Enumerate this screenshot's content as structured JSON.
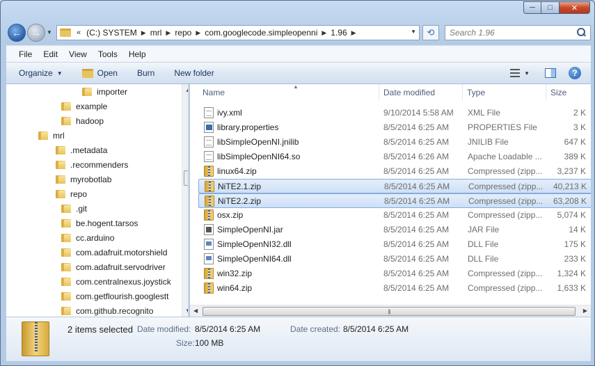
{
  "window": {
    "buttons": {
      "minimize": "─",
      "maximize": "□",
      "close": "✕"
    }
  },
  "address": {
    "prefix": "«",
    "crumbs": [
      "(C:) SYSTEM",
      "mrl",
      "repo",
      "com.googlecode.simpleopenni",
      "1.96"
    ],
    "search_placeholder": "Search 1.96"
  },
  "menu": [
    "File",
    "Edit",
    "View",
    "Tools",
    "Help"
  ],
  "commands": {
    "organize": "Organize",
    "open": "Open",
    "burn": "Burn",
    "new_folder": "New folder",
    "help": "?"
  },
  "tree": [
    {
      "label": "importer",
      "level": 3
    },
    {
      "label": "example",
      "level": 2
    },
    {
      "label": "hadoop",
      "level": 2
    },
    {
      "label": "mrl",
      "level": 0
    },
    {
      "label": ".metadata",
      "level": 1
    },
    {
      "label": ".recommenders",
      "level": 1
    },
    {
      "label": "myrobotlab",
      "level": 1
    },
    {
      "label": "repo",
      "level": 1
    },
    {
      "label": ".git",
      "level": 2
    },
    {
      "label": "be.hogent.tarsos",
      "level": 2
    },
    {
      "label": "cc.arduino",
      "level": 2
    },
    {
      "label": "com.adafruit.motorshield",
      "level": 2
    },
    {
      "label": "com.adafruit.servodriver",
      "level": 2
    },
    {
      "label": "com.centralnexus.joystick",
      "level": 2
    },
    {
      "label": "com.getflourish.googlestt",
      "level": 2
    },
    {
      "label": "com.github.recognito",
      "level": 2
    }
  ],
  "columns": {
    "name": "Name",
    "date": "Date modified",
    "type": "Type",
    "size": "Size"
  },
  "files": [
    {
      "name": "ivy.xml",
      "date": "9/10/2014 5:58 AM",
      "type": "XML File",
      "size": "2 K",
      "icon": "doc",
      "selected": false
    },
    {
      "name": "library.properties",
      "date": "8/5/2014 6:25 AM",
      "type": "PROPERTIES File",
      "size": "3 K",
      "icon": "prop",
      "selected": false
    },
    {
      "name": "libSimpleOpenNI.jnilib",
      "date": "8/5/2014 6:25 AM",
      "type": "JNILIB File",
      "size": "647 K",
      "icon": "doc",
      "selected": false
    },
    {
      "name": "libSimpleOpenNI64.so",
      "date": "8/5/2014 6:26 AM",
      "type": "Apache Loadable ...",
      "size": "389 K",
      "icon": "doc",
      "selected": false
    },
    {
      "name": "linux64.zip",
      "date": "8/5/2014 6:25 AM",
      "type": "Compressed (zipp...",
      "size": "3,237 K",
      "icon": "zip",
      "selected": false
    },
    {
      "name": "NiTE2.1.zip",
      "date": "8/5/2014 6:25 AM",
      "type": "Compressed (zipp...",
      "size": "40,213 K",
      "icon": "zip",
      "selected": true
    },
    {
      "name": "NiTE2.2.zip",
      "date": "8/5/2014 6:25 AM",
      "type": "Compressed (zipp...",
      "size": "63,208 K",
      "icon": "zip",
      "selected": true
    },
    {
      "name": "osx.zip",
      "date": "8/5/2014 6:25 AM",
      "type": "Compressed (zipp...",
      "size": "5,074 K",
      "icon": "zip",
      "selected": false
    },
    {
      "name": "SimpleOpenNI.jar",
      "date": "8/5/2014 6:25 AM",
      "type": "JAR File",
      "size": "14 K",
      "icon": "jar",
      "selected": false
    },
    {
      "name": "SimpleOpenNI32.dll",
      "date": "8/5/2014 6:25 AM",
      "type": "DLL File",
      "size": "175 K",
      "icon": "dll",
      "selected": false
    },
    {
      "name": "SimpleOpenNI64.dll",
      "date": "8/5/2014 6:25 AM",
      "type": "DLL File",
      "size": "233 K",
      "icon": "dll",
      "selected": false
    },
    {
      "name": "win32.zip",
      "date": "8/5/2014 6:25 AM",
      "type": "Compressed (zipp...",
      "size": "1,324 K",
      "icon": "zip",
      "selected": false
    },
    {
      "name": "win64.zip",
      "date": "8/5/2014 6:25 AM",
      "type": "Compressed (zipp...",
      "size": "1,633 K",
      "icon": "zip",
      "selected": false
    }
  ],
  "details": {
    "count": "2 items selected",
    "modified_label": "Date modified:",
    "modified_value": "8/5/2014 6:25 AM",
    "created_label": "Date created:",
    "created_value": "8/5/2014 6:25 AM",
    "size_label": "Size:",
    "size_value": "100 MB"
  },
  "colors": {
    "selection_bg": "#cde0f7",
    "selection_border": "#84acdd",
    "accent": "#2a5ea8"
  }
}
